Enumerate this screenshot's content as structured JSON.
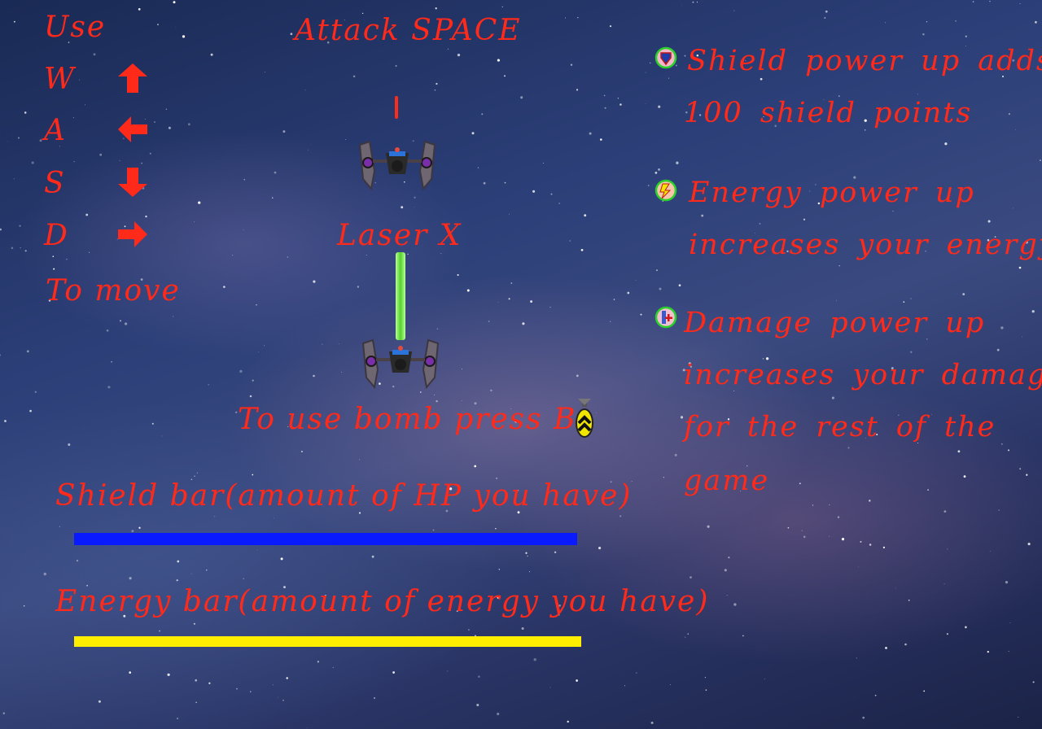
{
  "controls": {
    "use_label": "Use",
    "keys": [
      "W",
      "A",
      "S",
      "D"
    ],
    "move_label": "To move"
  },
  "attack": {
    "label": "Attack SPACE"
  },
  "laser": {
    "label": "Laser X"
  },
  "bomb": {
    "label": "To use bomb press B"
  },
  "bars": {
    "shield_label": "Shield bar(amount of HP you have)",
    "energy_label": "Energy bar(amount of energy you have)",
    "shield_color": "#0a1aff",
    "energy_color": "#ffee00"
  },
  "powerups": {
    "shield_line1": "Shield power up adds",
    "shield_line2": "100 shield points",
    "energy_line1": "Energy power up",
    "energy_line2": "increases your energy",
    "damage_line1": "Damage power up",
    "damage_line2": "increases your damage",
    "damage_line3": "for the rest of the",
    "damage_line4": "game"
  },
  "icons": {
    "up": "arrow-up-icon",
    "left": "arrow-left-icon",
    "down": "arrow-down-icon",
    "right": "arrow-right-icon"
  }
}
